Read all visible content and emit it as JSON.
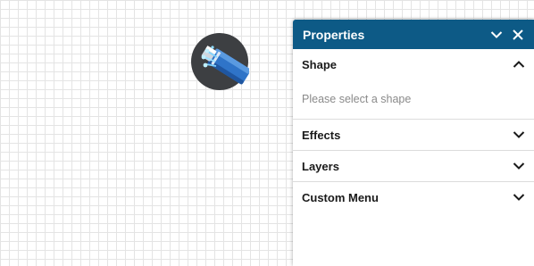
{
  "panel": {
    "title": "Properties",
    "sections": [
      {
        "label": "Shape",
        "expanded": true,
        "body_text": "Please select a shape"
      },
      {
        "label": "Effects",
        "expanded": false
      },
      {
        "label": "Layers",
        "expanded": false
      },
      {
        "label": "Custom Menu",
        "expanded": false
      }
    ]
  },
  "canvas": {
    "shape_icon": "fiber-optic-cable-icon"
  },
  "colors": {
    "header_bg": "#0d5a86",
    "grid_line": "#e4e4e4",
    "icon_circle": "#3d3f42",
    "cable_blue": "#2f74c8"
  }
}
